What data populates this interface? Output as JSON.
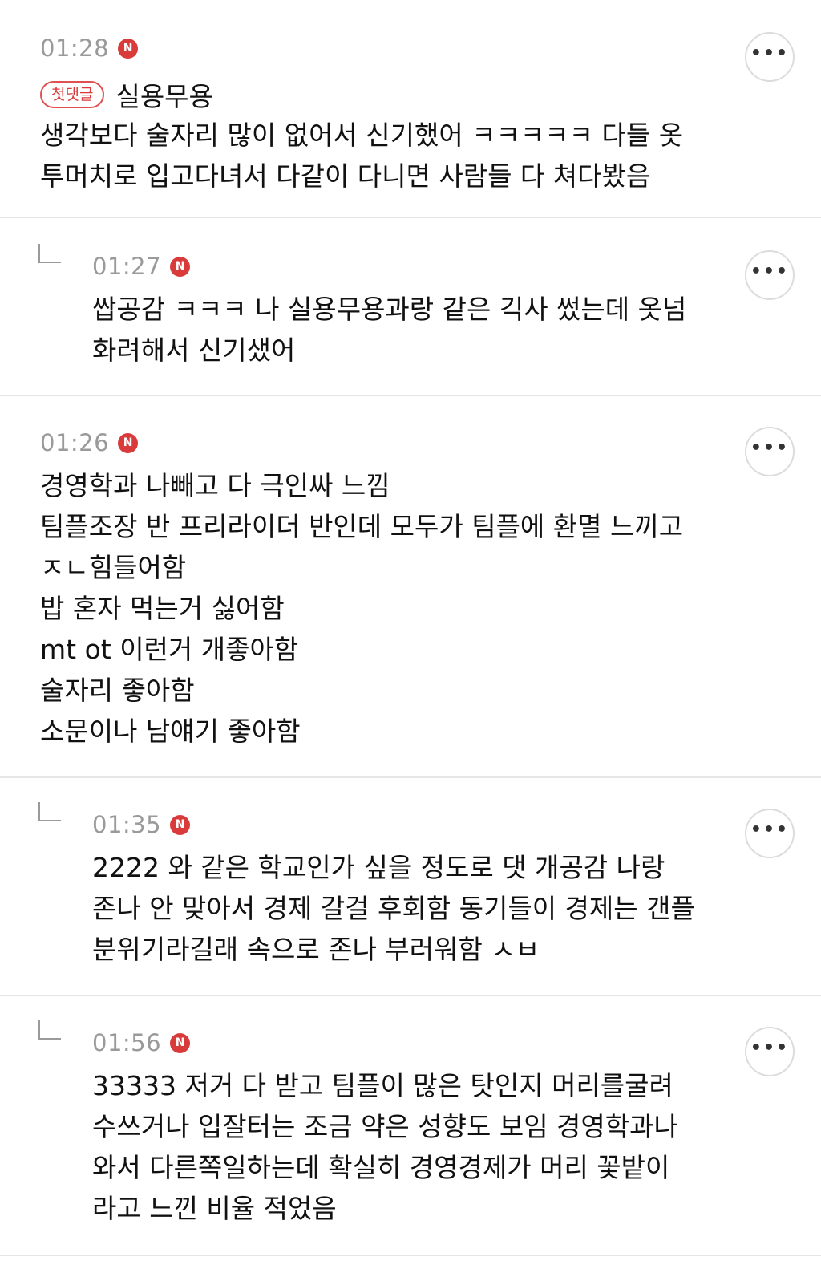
{
  "more_glyph": "•••",
  "first_comment_badge": "첫댓글",
  "comments": [
    {
      "time": "01:28",
      "new_badge": "N",
      "first_line": "실용무용",
      "text": "생각보다 술자리 많이 없어서 신기했어 ㅋㅋㅋㅋㅋ 다들 옷\n투머치로 입고다녀서 다같이 다니면 사람들 다 쳐다봤음"
    },
    {
      "time": "01:27",
      "new_badge": "N",
      "text": "쌉공감 ㅋㅋㅋ 나 실용무용과랑 같은 긱사 썼는데 옷넘\n화려해서 신기샜어"
    },
    {
      "time": "01:26",
      "new_badge": "N",
      "text": "경영학과 나빼고 다 극인싸 느낌\n팀플조장 반 프리라이더 반인데 모두가 팀플에 환멸 느끼고\nㅈㄴ힘들어함\n밥 혼자 먹는거 싫어함\nmt ot 이런거 개좋아함\n술자리 좋아함\n소문이나 남얘기 좋아함"
    },
    {
      "time": "01:35",
      "new_badge": "N",
      "text": "2222 와 같은 학교인가 싶을 정도로 댓 개공감 나랑\n존나 안 맞아서 경제 갈걸 후회함 동기들이 경제는 갠플\n분위기라길래 속으로 존나 부러워함 ㅅㅂ"
    },
    {
      "time": "01:56",
      "new_badge": "N",
      "text": "33333 저거 다 받고 팀플이 많은 탓인지 머리를굴려\n수쓰거나 입잘터는 조금 약은 성향도 보임 경영학과나\n와서 다른쪽일하는데 확실히 경영경제가 머리 꽃밭이\n라고 느낀 비율 적었음"
    }
  ]
}
